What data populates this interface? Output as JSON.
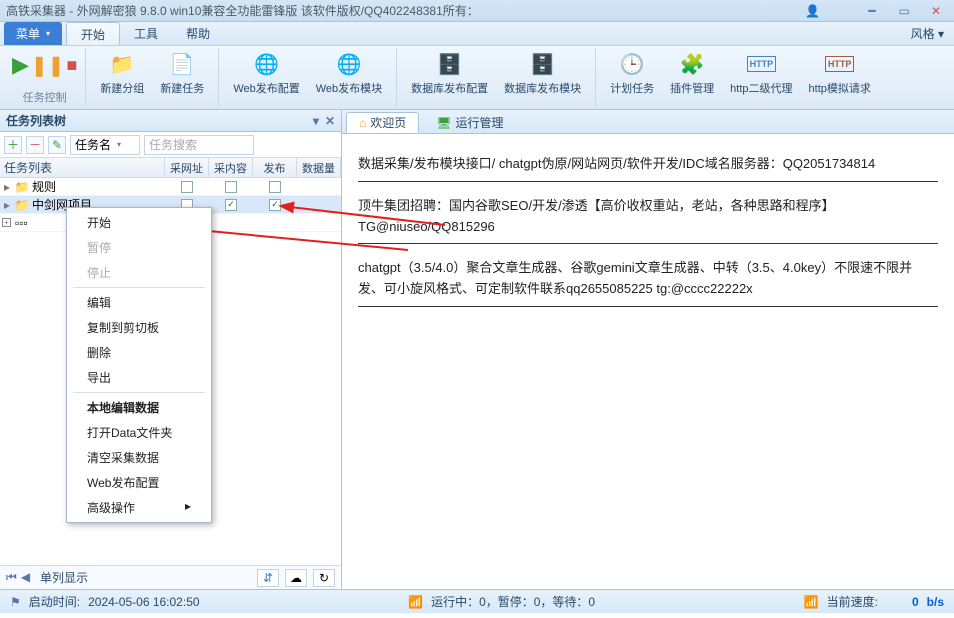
{
  "titlebar": {
    "text": "高铁采集器 - 外网解密狼 9.8.0 win10兼容全功能雷锋版 该软件版权/QQ402248381所有："
  },
  "menubar": {
    "menu_btn": "菜单",
    "tabs": [
      "开始",
      "工具",
      "帮助"
    ],
    "right": "风格"
  },
  "ribbon": {
    "task_ctrl_label": "任务控制",
    "buttons": {
      "new_group": "新建分组",
      "new_task": "新建任务",
      "web_pub_cfg": "Web发布配置",
      "web_pub_mod": "Web发布模块",
      "db_pub_cfg": "数据库发布配置",
      "db_pub_mod": "数据库发布模块",
      "plan_task": "计划任务",
      "plugin_mgr": "插件管理",
      "http2proxy": "http二级代理",
      "http_mock": "http模拟请求"
    }
  },
  "left": {
    "header": "任务列表树",
    "filter_label": "任务名",
    "search_placeholder": "任务搜索",
    "cols": {
      "name": "任务列表",
      "c1": "采网址",
      "c2": "采内容",
      "c3": "发布",
      "c4": "数据量"
    },
    "rows": [
      {
        "label": "规则"
      },
      {
        "label": "中剑网项目"
      }
    ]
  },
  "ctx": {
    "start": "开始",
    "pause": "暂停",
    "stop": "停止",
    "edit": "编辑",
    "copy_clip": "复制到剪切板",
    "delete": "删除",
    "export": "导出",
    "local_edit": "本地编辑数据",
    "open_data": "打开Data文件夹",
    "clear_data": "清空采集数据",
    "web_cfg": "Web发布配置",
    "adv": "高级操作"
  },
  "left_bottom": {
    "label": "单列显示"
  },
  "right_tabs": {
    "welcome": "欢迎页",
    "runmgr": "运行管理"
  },
  "welcome": {
    "l1": "数据采集/发布模块接口/ chatgpt伪原/网站网页/软件开发/IDC域名服务器：QQ2051734814",
    "l2": "顶牛集团招聘：国内谷歌SEO/开发/渗透【高价收权重站，老站，各种思路和程序】TG@niuseo/QQ815296",
    "l3": "chatgpt（3.5/4.0）聚合文章生成器、谷歌gemini文章生成器、中转（3.5、4.0key）不限速不限并发、可小旋风格式、可定制软件联系qq2655085225 tg:@cccc22222x"
  },
  "status": {
    "start_time_label": "启动时间:",
    "start_time": "2024-05-06 16:02:50",
    "running": "运行中：0，暂停：0，等待：0",
    "speed_label": "当前速度:",
    "speed_val": "0",
    "speed_unit": "b/s"
  }
}
